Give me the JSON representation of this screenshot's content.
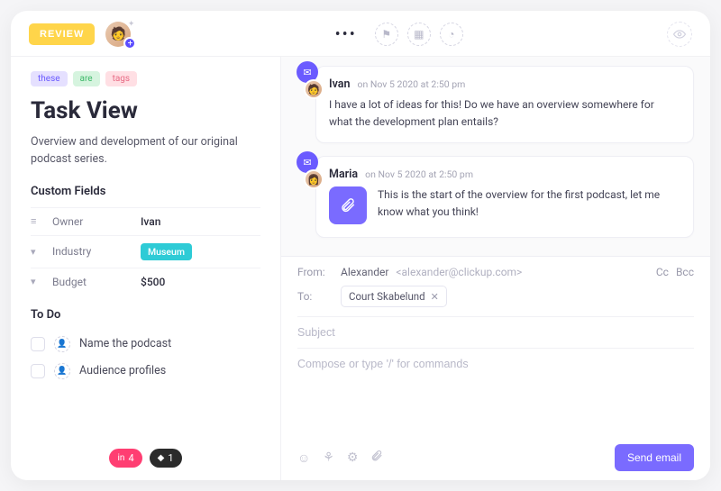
{
  "header": {
    "review_label": "REVIEW"
  },
  "tags": [
    "these",
    "are",
    "tags"
  ],
  "task": {
    "title": "Task View",
    "description": "Overview and development of our original podcast series."
  },
  "custom_fields": {
    "heading": "Custom Fields",
    "rows": [
      {
        "label": "Owner",
        "value": "Ivan"
      },
      {
        "label": "Industry",
        "value": "Museum"
      },
      {
        "label": "Budget",
        "value": "$500"
      }
    ]
  },
  "todo": {
    "heading": "To Do",
    "items": [
      {
        "label": "Name the podcast"
      },
      {
        "label": "Audience profiles"
      }
    ]
  },
  "footer_chips": {
    "pink_count": "4",
    "dark_count": "1"
  },
  "activity": [
    {
      "author": "Ivan",
      "timestamp": "on Nov 5 2020 at 2:50 pm",
      "body": "I have a lot of ideas for this! Do we have an overview somewhere for what the development plan entails?"
    },
    {
      "author": "Maria",
      "timestamp": "on Nov 5 2020 at 2:50 pm",
      "body": "This is the start of the overview for the first podcast, let me know what you think!"
    }
  ],
  "composer": {
    "from_label": "From:",
    "from_name": "Alexander",
    "from_email": "<alexander@clickup.com>",
    "cc_label": "Cc",
    "bcc_label": "Bcc",
    "to_label": "To:",
    "recipient": "Court Skabelund",
    "subject_placeholder": "Subject",
    "body_placeholder": "Compose or type '/' for commands",
    "send_label": "Send email"
  }
}
